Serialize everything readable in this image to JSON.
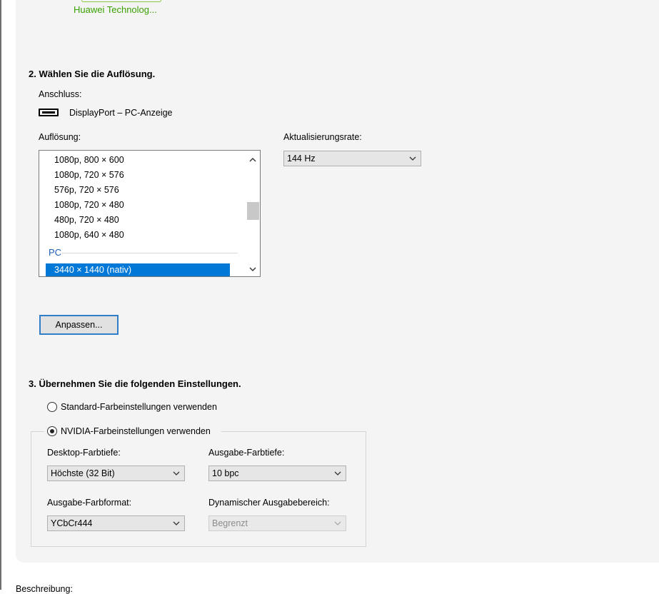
{
  "vendor": {
    "name": "Huawei Technolog..."
  },
  "section2": {
    "heading": "2. Wählen Sie die Auflösung.",
    "connection_label": "Anschluss:",
    "connection_value": "DisplayPort – PC-Anzeige",
    "resolution_label": "Auflösung:",
    "resolutions": [
      "1080p, 800 × 600",
      "1080p, 720 × 576",
      "576p, 720 × 576",
      "1080p, 720 × 480",
      "480p, 720 × 480",
      "1080p, 640 × 480"
    ],
    "group_pc": "PC",
    "selected_resolution": "3440 × 1440 (nativ)",
    "refresh_label": "Aktualisierungsrate:",
    "refresh_value": "144 Hz",
    "customize_button": "Anpassen..."
  },
  "section3": {
    "heading": "3. Übernehmen Sie die folgenden Einstellungen.",
    "radio_default": "Standard-Farbeinstellungen verwenden",
    "radio_nvidia": "NVIDIA-Farbeinstellungen verwenden",
    "desktop_depth_label": "Desktop-Farbtiefe:",
    "desktop_depth_value": "Höchste (32 Bit)",
    "output_depth_label": "Ausgabe-Farbtiefe:",
    "output_depth_value": "10 bpc",
    "output_format_label": "Ausgabe-Farbformat:",
    "output_format_value": "YCbCr444",
    "dynamic_range_label": "Dynamischer Ausgabebereich:",
    "dynamic_range_value": "Begrenzt"
  },
  "footer": {
    "description_label": "Beschreibung:"
  },
  "colors": {
    "accent": "#0078d7",
    "vendor_green": "#3aa000",
    "group_blue": "#1a5fb4"
  }
}
